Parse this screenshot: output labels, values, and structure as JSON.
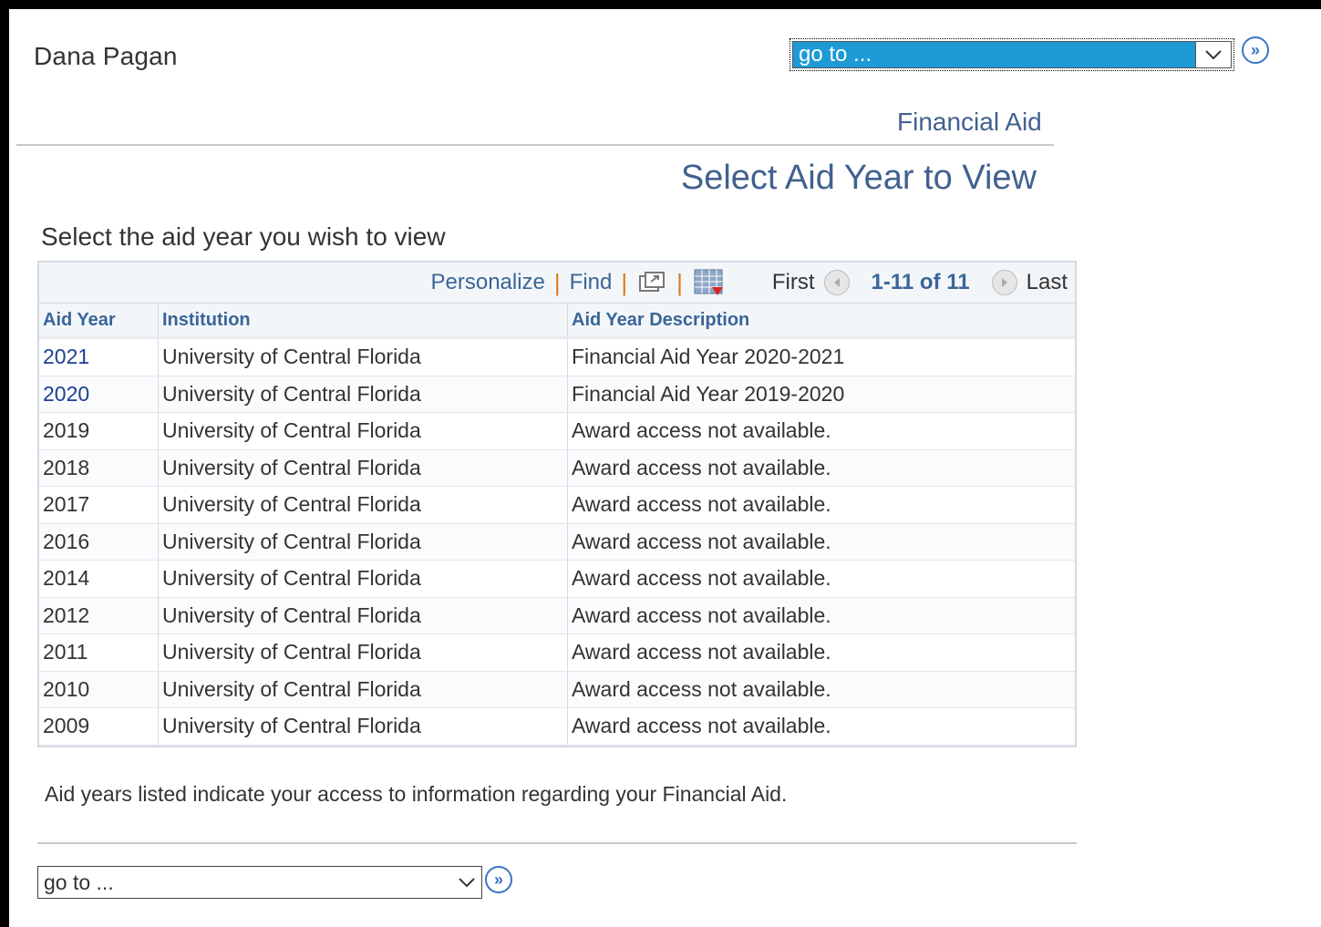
{
  "header": {
    "student_name": "Dana Pagan",
    "goto_select_value": "go to ...",
    "section_link": "Financial Aid"
  },
  "page": {
    "title": "Select Aid Year to View",
    "instructions": "Select the aid year you wish to view"
  },
  "grid_nav": {
    "personalize": "Personalize",
    "find": "Find",
    "first": "First",
    "count": "1-11 of 11",
    "last": "Last"
  },
  "columns": [
    "Aid Year",
    "Institution",
    "Aid Year Description"
  ],
  "rows": [
    {
      "year": "2021",
      "institution": "University of Central Florida",
      "description": "Financial Aid Year 2020-2021",
      "link": true
    },
    {
      "year": "2020",
      "institution": "University of Central Florida",
      "description": "Financial Aid Year 2019-2020",
      "link": true
    },
    {
      "year": "2019",
      "institution": "University of Central Florida",
      "description": "Award access not available.",
      "link": false
    },
    {
      "year": "2018",
      "institution": "University of Central Florida",
      "description": "Award access not available.",
      "link": false
    },
    {
      "year": "2017",
      "institution": "University of Central Florida",
      "description": "Award access not available.",
      "link": false
    },
    {
      "year": "2016",
      "institution": "University of Central Florida",
      "description": "Award access not available.",
      "link": false
    },
    {
      "year": "2014",
      "institution": "University of Central Florida",
      "description": "Award access not available.",
      "link": false
    },
    {
      "year": "2012",
      "institution": "University of Central Florida",
      "description": "Award access not available.",
      "link": false
    },
    {
      "year": "2011",
      "institution": "University of Central Florida",
      "description": "Award access not available.",
      "link": false
    },
    {
      "year": "2010",
      "institution": "University of Central Florida",
      "description": "Award access not available.",
      "link": false
    },
    {
      "year": "2009",
      "institution": "University of Central Florida",
      "description": "Award access not available.",
      "link": false
    }
  ],
  "footer": {
    "note": "Aid years listed indicate your access to information regarding your Financial Aid.",
    "goto_select_value": "go to ..."
  },
  "icons": {
    "go": "double-chevron-right-icon",
    "new_window": "new-window-icon",
    "download": "download-grid-icon",
    "prev": "left-arrow-icon",
    "next": "right-arrow-icon"
  },
  "colors": {
    "select_highlight": "#1e9ad6",
    "link": "#3a6599",
    "title": "#41618f",
    "separator": "#d8791e"
  }
}
